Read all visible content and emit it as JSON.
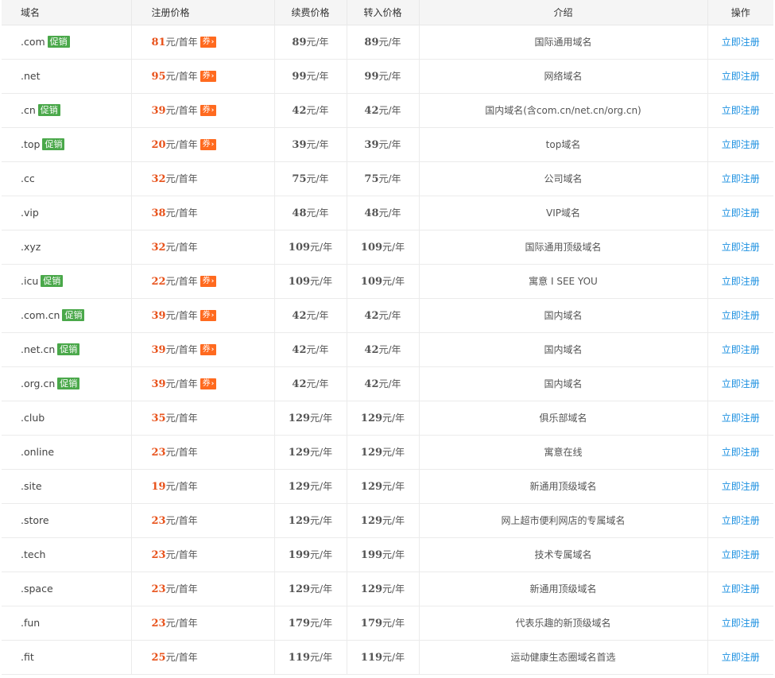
{
  "table": {
    "headers": {
      "domain": "域名",
      "register_price": "注册价格",
      "renew_price": "续费价格",
      "transfer_price": "转入价格",
      "intro": "介绍",
      "action": "操作"
    },
    "price_unit_first_year": "元/首年",
    "price_unit_year": "元/年",
    "promo_label": "促销",
    "coupon_label": "券",
    "coupon_chevron": "›",
    "action_label": "立即注册",
    "rows": [
      {
        "domain": ".com",
        "promo": true,
        "reg": "81",
        "coupon": true,
        "renew": "89",
        "transfer": "89",
        "intro": "国际通用域名"
      },
      {
        "domain": ".net",
        "promo": false,
        "reg": "95",
        "coupon": true,
        "renew": "99",
        "transfer": "99",
        "intro": "网络域名"
      },
      {
        "domain": ".cn",
        "promo": true,
        "reg": "39",
        "coupon": true,
        "renew": "42",
        "transfer": "42",
        "intro": "国内域名(含com.cn/net.cn/org.cn)"
      },
      {
        "domain": ".top",
        "promo": true,
        "reg": "20",
        "coupon": true,
        "renew": "39",
        "transfer": "39",
        "intro": "top域名"
      },
      {
        "domain": ".cc",
        "promo": false,
        "reg": "32",
        "coupon": false,
        "renew": "75",
        "transfer": "75",
        "intro": "公司域名"
      },
      {
        "domain": ".vip",
        "promo": false,
        "reg": "38",
        "coupon": false,
        "renew": "48",
        "transfer": "48",
        "intro": "VIP域名"
      },
      {
        "domain": ".xyz",
        "promo": false,
        "reg": "32",
        "coupon": false,
        "renew": "109",
        "transfer": "109",
        "intro": "国际通用顶级域名"
      },
      {
        "domain": ".icu",
        "promo": true,
        "reg": "22",
        "coupon": true,
        "renew": "109",
        "transfer": "109",
        "intro": "寓意 I SEE YOU"
      },
      {
        "domain": ".com.cn",
        "promo": true,
        "reg": "39",
        "coupon": true,
        "renew": "42",
        "transfer": "42",
        "intro": "国内域名"
      },
      {
        "domain": ".net.cn",
        "promo": true,
        "reg": "39",
        "coupon": true,
        "renew": "42",
        "transfer": "42",
        "intro": "国内域名"
      },
      {
        "domain": ".org.cn",
        "promo": true,
        "reg": "39",
        "coupon": true,
        "renew": "42",
        "transfer": "42",
        "intro": "国内域名"
      },
      {
        "domain": ".club",
        "promo": false,
        "reg": "35",
        "coupon": false,
        "renew": "129",
        "transfer": "129",
        "intro": "俱乐部域名"
      },
      {
        "domain": ".online",
        "promo": false,
        "reg": "23",
        "coupon": false,
        "renew": "129",
        "transfer": "129",
        "intro": "寓意在线"
      },
      {
        "domain": ".site",
        "promo": false,
        "reg": "19",
        "coupon": false,
        "renew": "129",
        "transfer": "129",
        "intro": "新通用顶级域名"
      },
      {
        "domain": ".store",
        "promo": false,
        "reg": "23",
        "coupon": false,
        "renew": "129",
        "transfer": "129",
        "intro": "网上超市便利网店的专属域名"
      },
      {
        "domain": ".tech",
        "promo": false,
        "reg": "23",
        "coupon": false,
        "renew": "199",
        "transfer": "199",
        "intro": "技术专属域名"
      },
      {
        "domain": ".space",
        "promo": false,
        "reg": "23",
        "coupon": false,
        "renew": "129",
        "transfer": "129",
        "intro": "新通用顶级域名"
      },
      {
        "domain": ".fun",
        "promo": false,
        "reg": "23",
        "coupon": false,
        "renew": "179",
        "transfer": "179",
        "intro": "代表乐趣的新顶级域名"
      },
      {
        "domain": ".fit",
        "promo": false,
        "reg": "25",
        "coupon": false,
        "renew": "119",
        "transfer": "119",
        "intro": "运动健康生态圈域名首选"
      }
    ]
  },
  "colors": {
    "price_accent": "#e8531c",
    "promo_tag": "#4aa84a",
    "coupon_tag": "#ff6a1f",
    "link": "#1a8fe0"
  }
}
